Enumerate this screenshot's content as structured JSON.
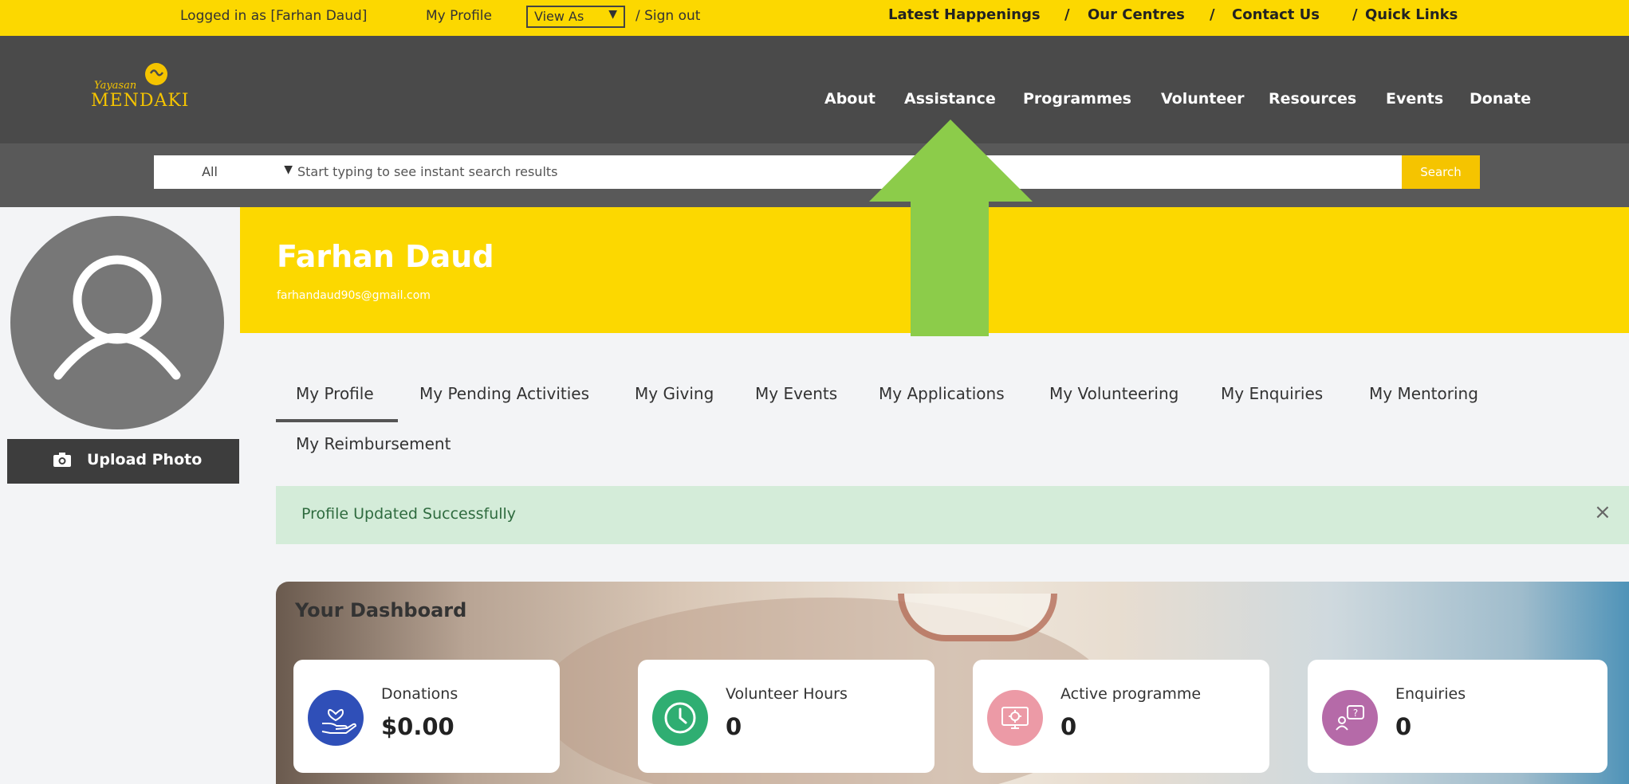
{
  "topbar": {
    "logged_in": "Logged in as [Farhan Daud]",
    "my_profile": "My Profile",
    "view_as": "View As",
    "sign_out": "/  Sign out",
    "quick_links": [
      "Latest Happenings",
      "/",
      "Our Centres",
      "/",
      "Contact Us",
      "/",
      "Quick Links"
    ]
  },
  "header": {
    "logo_text_top": "Yayasan",
    "logo_text": "MENDAKI",
    "nav": [
      "About",
      "Assistance",
      "Programmes",
      "Volunteer",
      "Resources",
      "Events",
      "Donate"
    ]
  },
  "search": {
    "category": "All",
    "placeholder": "Start typing to see instant search results",
    "button": "Search"
  },
  "profile": {
    "name": "Farhan Daud",
    "email": "farhandaud90s@gmail.com",
    "upload_label": "Upload Photo"
  },
  "tabs": [
    "My Profile",
    "My Pending Activities",
    "My Giving",
    "My Events",
    "My Applications",
    "My Volunteering",
    "My Enquiries",
    "My Mentoring",
    "My Reimbursement"
  ],
  "active_tab": "My Profile",
  "alert": {
    "message": "Profile Updated Successfully",
    "close": "×"
  },
  "dashboard": {
    "title": "Your Dashboard",
    "cards": [
      {
        "label": "Donations",
        "value": "$0.00",
        "icon": "hand-heart-icon",
        "color": "#2f4fb8"
      },
      {
        "label": "Volunteer Hours",
        "value": "0",
        "icon": "clock-icon",
        "color": "#2fae72"
      },
      {
        "label": "Active programme",
        "value": "0",
        "icon": "gear-monitor-icon",
        "color": "#ec9aa6"
      },
      {
        "label": "Enquiries",
        "value": "0",
        "icon": "question-chat-icon",
        "color": "#b56aa8"
      }
    ]
  },
  "colors": {
    "brand_yellow": "#fcd800",
    "header_dark": "#4a4a4a",
    "arrow_green": "#8ccc4a"
  }
}
